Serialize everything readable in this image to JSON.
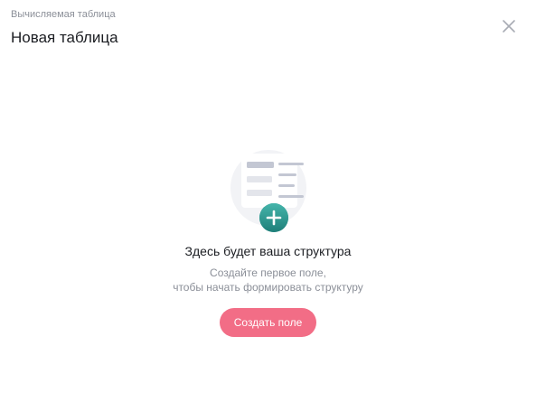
{
  "header": {
    "subtitle": "Вычисляемая таблица",
    "title": "Новая таблица",
    "close_icon": "close-icon"
  },
  "empty_state": {
    "illustration_icon": "table-add-icon",
    "title": "Здесь будет ваша структура",
    "description_line1": "Создайте первое поле,",
    "description_line2": "чтобы начать формировать структуру",
    "button_label": "Создать поле"
  },
  "colors": {
    "accent_button": "#f26d86",
    "plus_badge": "#2f9a93",
    "muted_text": "#8b8f98",
    "primary_text": "#1b1d22"
  }
}
